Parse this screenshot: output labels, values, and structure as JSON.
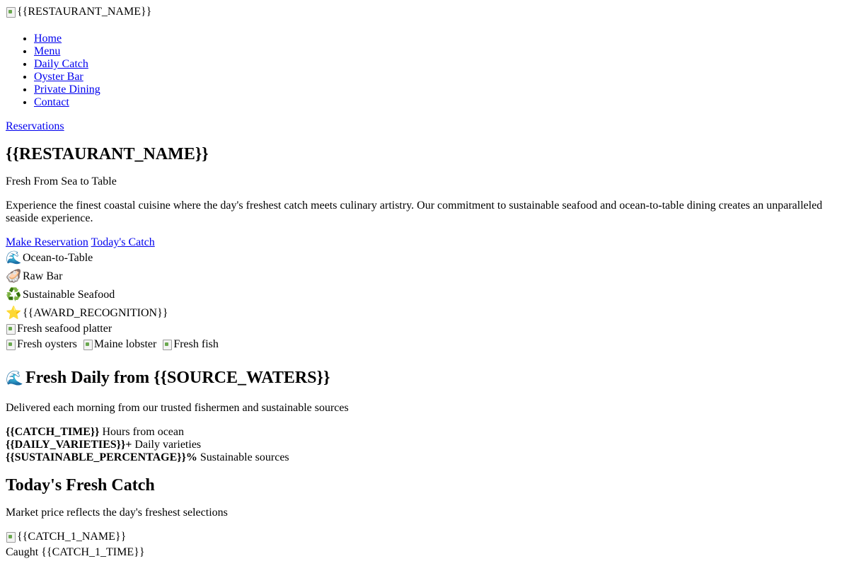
{
  "header": {
    "logo_alt": "{{RESTAURANT_NAME}}",
    "logo_icon": "broken-image-icon"
  },
  "nav": {
    "items": [
      {
        "label": "Home"
      },
      {
        "label": "Menu"
      },
      {
        "label": "Daily Catch"
      },
      {
        "label": "Oyster Bar"
      },
      {
        "label": "Private Dining"
      },
      {
        "label": "Contact"
      }
    ],
    "reservations_label": "Reservations"
  },
  "hero": {
    "title": "{{RESTAURANT_NAME}}",
    "tagline": "Fresh From Sea to Table",
    "description": "Experience the finest coastal cuisine where the day's freshest catch meets culinary artistry. Our commitment to sustainable seafood and ocean-to-table dining creates an unparalleled seaside experience.",
    "cta_primary": "Make Reservation",
    "cta_secondary": "Today's Catch",
    "features": [
      {
        "icon": "🌊",
        "icon_name": "wave-icon",
        "label": "Ocean-to-Table"
      },
      {
        "icon": "🦪",
        "icon_name": "oyster-icon",
        "label": "Raw Bar"
      },
      {
        "icon": "♻️",
        "icon_name": "recycle-icon",
        "label": "Sustainable Seafood"
      },
      {
        "icon": "⭐",
        "icon_name": "star-icon",
        "label": "{{AWARD_RECOGNITION}}"
      }
    ],
    "main_image_alt": "Fresh seafood platter",
    "thumb_images": [
      {
        "alt": "Fresh oysters"
      },
      {
        "alt": "Maine lobster"
      },
      {
        "alt": "Fresh fish"
      }
    ]
  },
  "source": {
    "icon": "🌊",
    "title": "Fresh Daily from {{SOURCE_WATERS}}",
    "subtitle": "Delivered each morning from our trusted fishermen and sustainable sources",
    "stats": [
      {
        "value": "{{CATCH_TIME}}",
        "label": "Hours from ocean"
      },
      {
        "value": "{{DAILY_VARIETIES}}+",
        "label": "Daily varieties"
      },
      {
        "value": "{{SUSTAINABLE_PERCENTAGE}}%",
        "label": "Sustainable sources"
      }
    ]
  },
  "catch": {
    "title": "Today's Fresh Catch",
    "subtitle": "Market price reflects the day's freshest selections",
    "items": [
      {
        "image_alt": "{{CATCH_1_NAME}}",
        "caught": "Caught {{CATCH_1_TIME}}"
      }
    ]
  }
}
